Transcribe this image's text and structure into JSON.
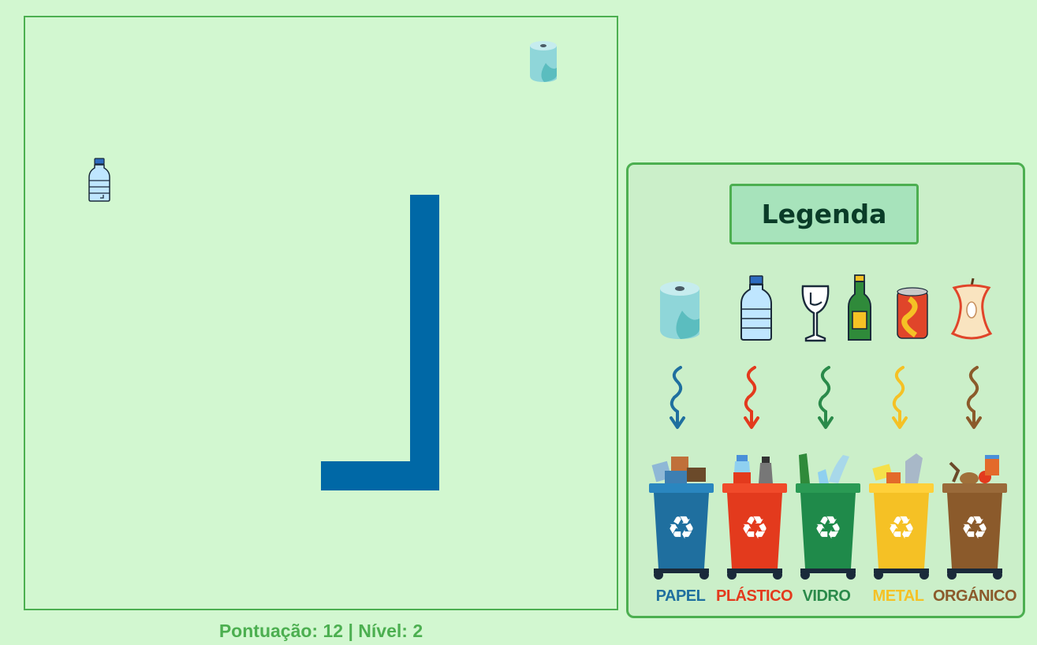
{
  "score": {
    "score_label": "Pontuação",
    "score_value": "12",
    "level_label": "Nível",
    "level_value": "2"
  },
  "legend": {
    "title": "Legenda",
    "icons": [
      "paper-roll-icon",
      "plastic-bottle-icon",
      "wine-glass-icon",
      "glass-bottle-icon",
      "soda-can-icon",
      "apple-core-icon"
    ],
    "bins": [
      {
        "label": "PAPEL",
        "color": "#1f6f9f"
      },
      {
        "label": "PLÁSTICO",
        "color": "#e33a1d"
      },
      {
        "label": "VIDRO",
        "color": "#2a8a4a"
      },
      {
        "label": "METAL",
        "color": "#f5c125"
      },
      {
        "label": "ORGÁNICO",
        "color": "#8b5a2b"
      }
    ]
  },
  "board": {
    "items": [
      "paper-roll-icon",
      "plastic-bottle-icon"
    ],
    "snake_color": "#0068a6"
  },
  "colors": {
    "background": "#d2f7d0",
    "accent": "#4caf50"
  }
}
